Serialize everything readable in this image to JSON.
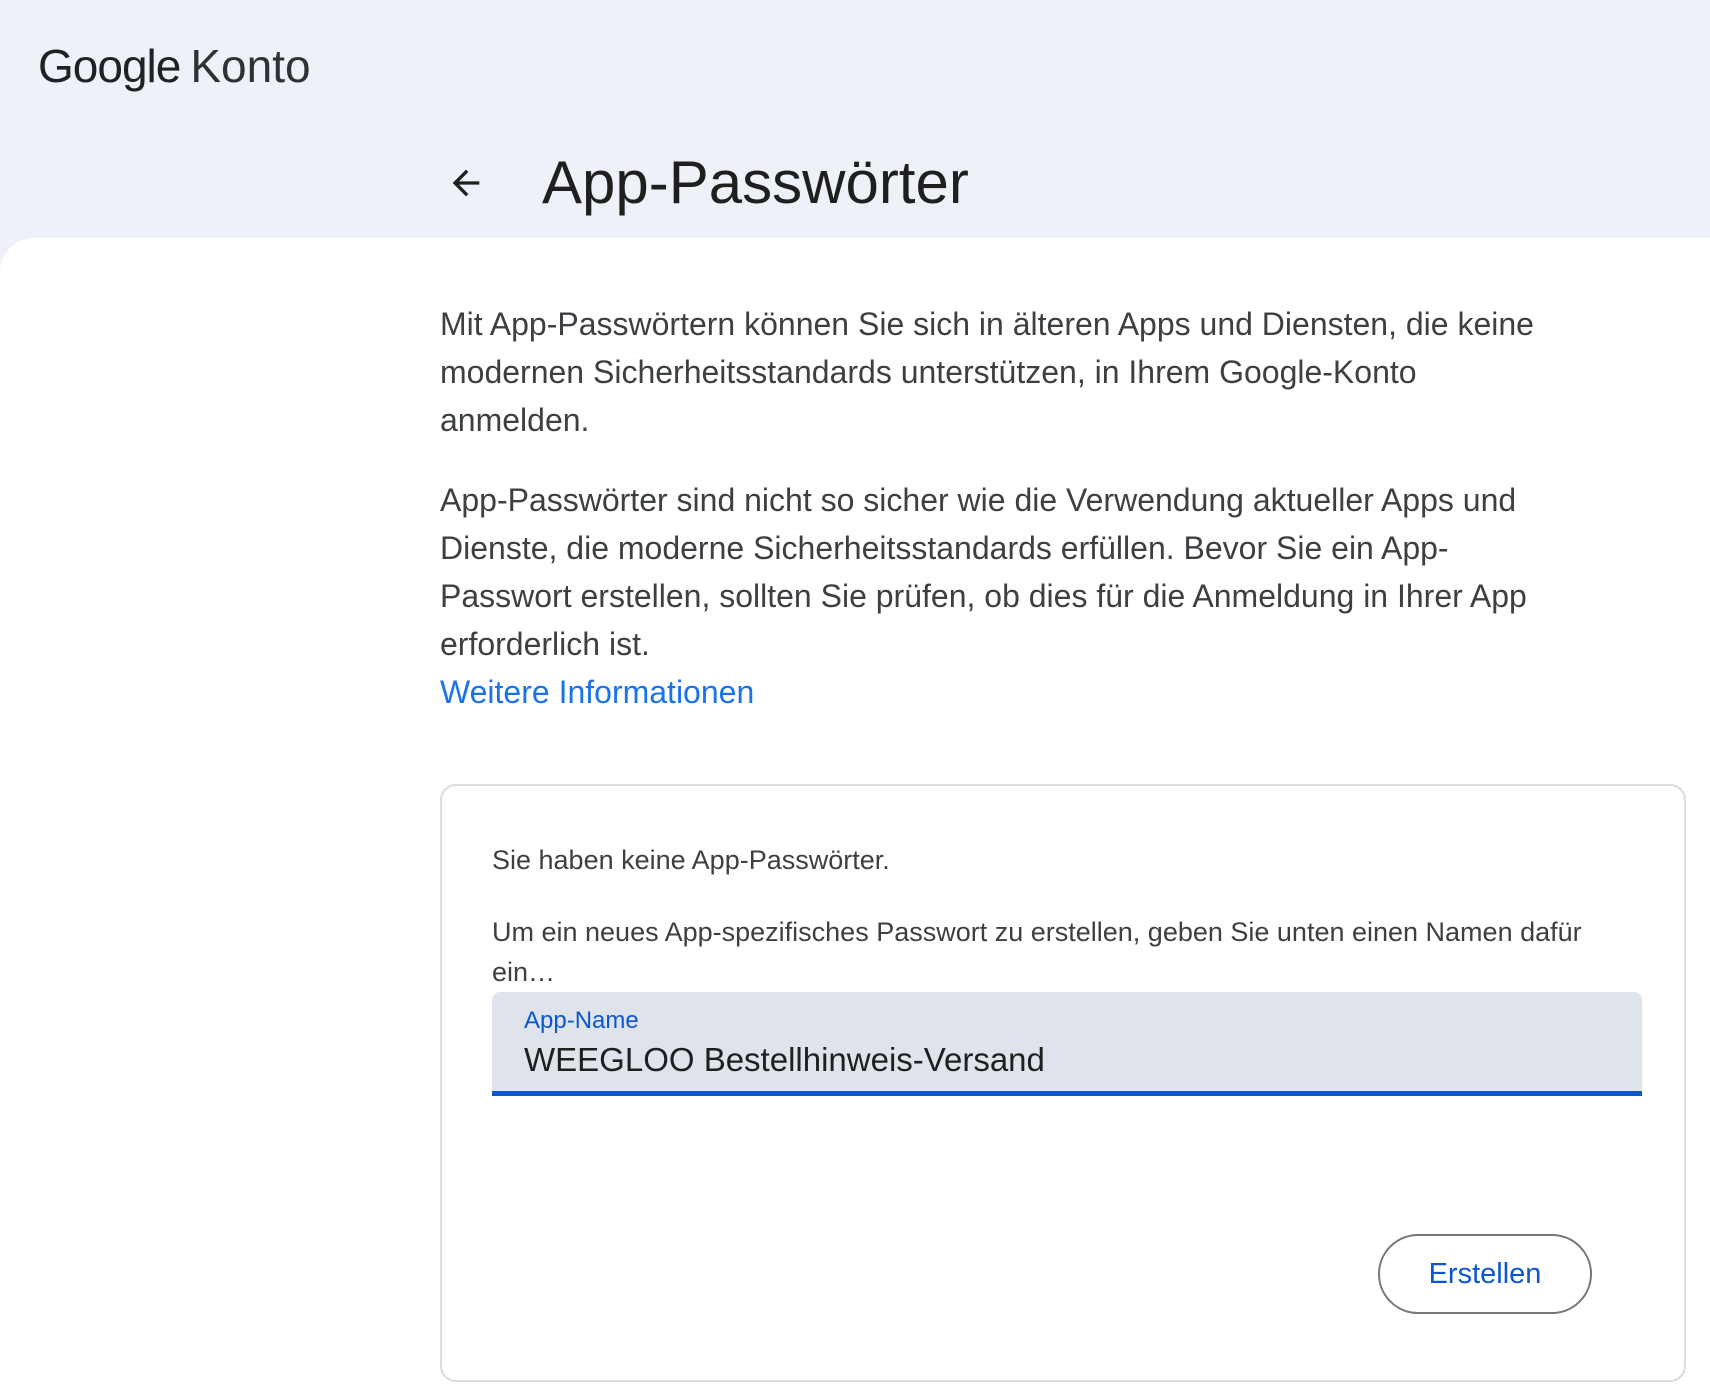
{
  "brand": {
    "google": "Google",
    "product": "Konto"
  },
  "header": {
    "back_icon": "arrow-left-icon",
    "title": "App-Passwörter"
  },
  "intro": {
    "paragraph1": "Mit App-Passwörtern können Sie sich in älteren Apps und Diensten, die keine modernen Sicherheitsstandards unterstützen, in Ihrem Google-Konto anmelden.",
    "paragraph2": "App-Passwörter sind nicht so sicher wie die Verwendung aktueller Apps und Dienste, die moderne Sicherheitsstandards erfüllen. Bevor Sie ein App-Passwort erstellen, sollten Sie prüfen, ob dies für die Anmeldung in Ihrer App erforderlich ist.",
    "learn_more": "Weitere Informationen"
  },
  "card": {
    "empty_text": "Sie haben keine App-Passwörter.",
    "instruction": "Um ein neues App-spezifisches Passwort zu erstellen, geben Sie unten einen Namen dafür ein…",
    "field_label": "App-Name",
    "field_value": "WEEGLOO Bestellhinweis-Versand",
    "create_label": "Erstellen"
  },
  "colors": {
    "background": "#eef2f8",
    "accent": "#0b57d0",
    "link": "#1a73e8",
    "field_bg": "#dfe3eb"
  }
}
